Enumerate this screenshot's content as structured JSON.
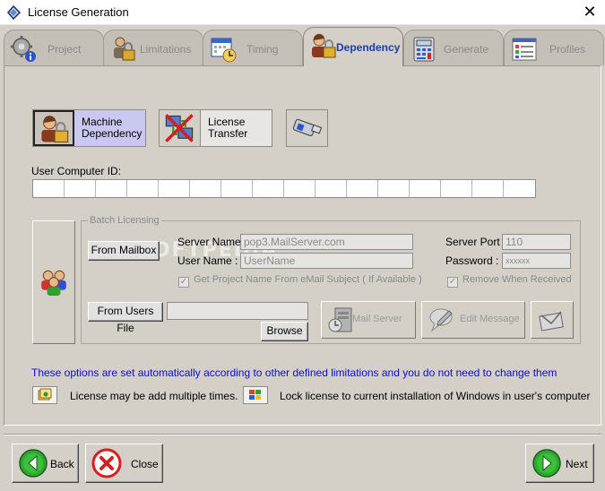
{
  "window": {
    "title": "License Generation",
    "close_glyph": "✕"
  },
  "tabs": [
    {
      "label": "Project",
      "icon": "gear-info-icon",
      "active": false
    },
    {
      "label": "Limitations",
      "icon": "lock-user-icon",
      "active": false
    },
    {
      "label": "Timing",
      "icon": "calendar-clock-icon",
      "active": false
    },
    {
      "label": "Dependency",
      "icon": "user-lock-icon",
      "active": true
    },
    {
      "label": "Generate",
      "icon": "calculator-icon",
      "active": false
    },
    {
      "label": "Profiles",
      "icon": "form-list-icon",
      "active": false
    }
  ],
  "dependency": {
    "machine_label": "Machine\nDependency",
    "transfer_label": "License\nTransfer",
    "usb_icon": "usb-drive-icon",
    "user_id_label": "User Computer ID:"
  },
  "batch": {
    "legend": "Batch Licensing",
    "from_mailbox": "From Mailbox",
    "server_name_label": "Server Name :",
    "server_name_value": "pop3.MailServer.com",
    "user_name_label": "User Name :",
    "user_name_value": "UserName",
    "server_port_label": "Server Port :",
    "server_port_value": "110",
    "password_label": "Password :",
    "password_value": "xxxxxx",
    "get_project_name": "Get Project Name From eMail Subject ( If Available )",
    "remove_when_received": "Remove When Received",
    "from_users_file": "From Users File",
    "users_file_value": "",
    "browse": "Browse",
    "mail_server": "Mail Server",
    "edit_message": "Edit Message",
    "watermark": "SOFTPEDIA"
  },
  "info_text": "These options are set automatically according to other defined limitations and you do not need to change them",
  "limits": {
    "multiple": "License may be add multiple times.",
    "lock_windows": "Lock license to current installation of Windows in user's computer"
  },
  "nav": {
    "back": "Back",
    "close": "Close",
    "next": "Next"
  },
  "colors": {
    "info_text": "#0b0bd0",
    "active_tab_text": "#1a3fa6",
    "selected_button": "#c8c8f0",
    "green": "#2fa82f",
    "red": "#d42020"
  }
}
